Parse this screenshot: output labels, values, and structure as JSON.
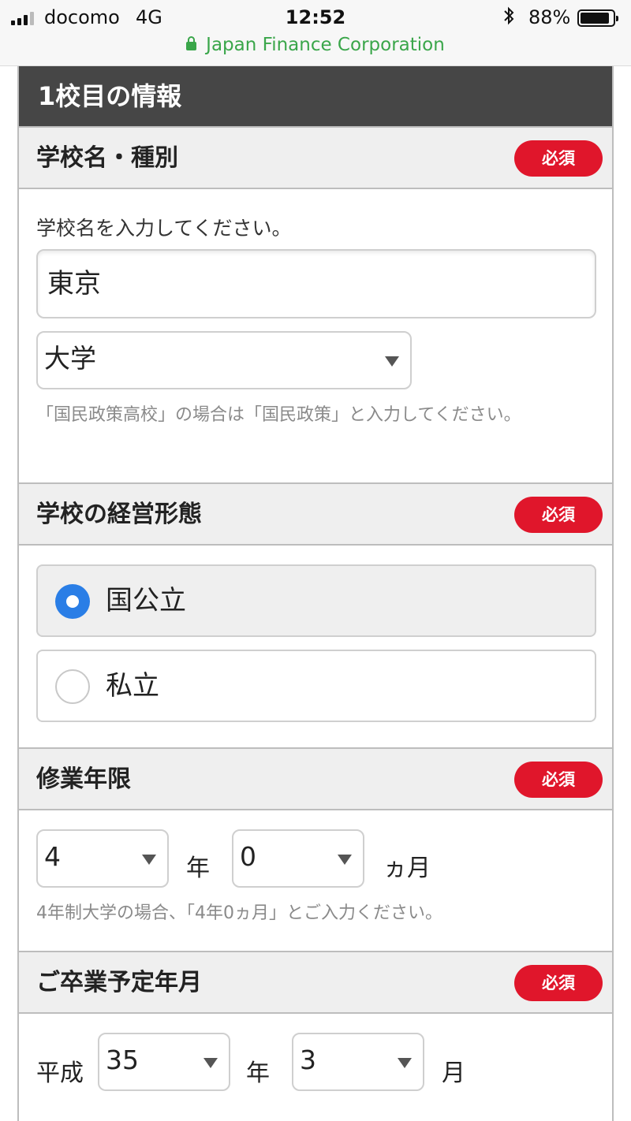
{
  "status_bar": {
    "carrier": "docomo",
    "network": "4G",
    "time": "12:52",
    "battery": "88%",
    "url": "Japan Finance Corporation",
    "icons": [
      "signal-icon",
      "bluetooth-icon",
      "battery-icon",
      "lock-icon"
    ]
  },
  "card": {
    "title": "1校目の情報"
  },
  "required_label": "必須",
  "school_name": {
    "heading": "学校名・種別",
    "prompt": "学校名を入力してください。",
    "value": "東京",
    "type_value": "大学",
    "note": "「国民政策高校」の場合は「国民政策」と入力してください。"
  },
  "management": {
    "heading": "学校の経営形態",
    "options": [
      {
        "label": "国公立",
        "selected": true
      },
      {
        "label": "私立",
        "selected": false
      }
    ]
  },
  "study_period": {
    "heading": "修業年限",
    "years": "4",
    "years_unit": "年",
    "months": "0",
    "months_unit": "ヵ月",
    "note": "4年制大学の場合、「4年0ヵ月」とご入力ください。"
  },
  "graduation": {
    "heading": "ご卒業予定年月",
    "era": "平成",
    "year": "35",
    "year_unit": "年",
    "month": "3",
    "month_unit": "月"
  },
  "colors": {
    "required_badge": "#e0162b",
    "radio_selected": "#2a7ee6",
    "url_green": "#3aa64a",
    "card_header": "#464646"
  }
}
